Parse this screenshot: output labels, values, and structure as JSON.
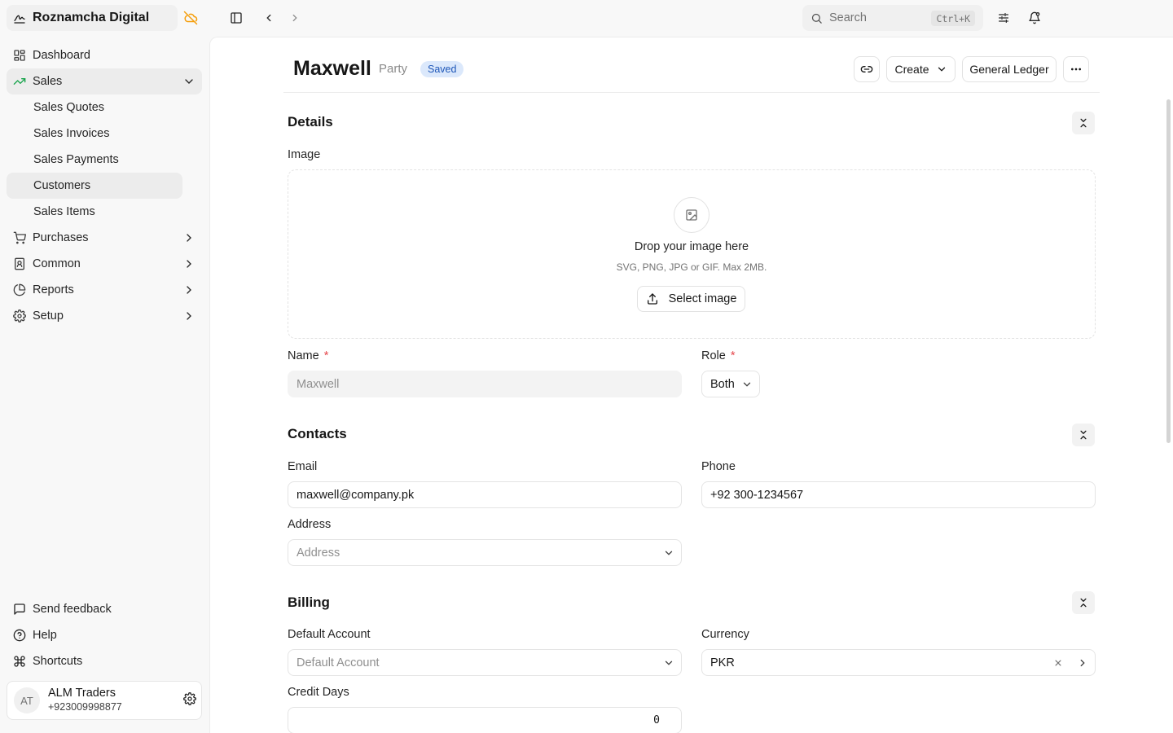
{
  "app": {
    "name": "Roznamcha Digital"
  },
  "sidebar": {
    "items": [
      {
        "label": "Dashboard"
      },
      {
        "label": "Sales",
        "expanded": true
      },
      {
        "label": "Purchases"
      },
      {
        "label": "Common"
      },
      {
        "label": "Reports"
      },
      {
        "label": "Setup"
      }
    ],
    "sales_sub": [
      {
        "label": "Sales Quotes"
      },
      {
        "label": "Sales Invoices"
      },
      {
        "label": "Sales Payments"
      },
      {
        "label": "Customers",
        "active": true
      },
      {
        "label": "Sales Items"
      }
    ],
    "footer": [
      {
        "label": "Send feedback"
      },
      {
        "label": "Help"
      },
      {
        "label": "Shortcuts"
      }
    ],
    "account": {
      "initials": "AT",
      "name": "ALM Traders",
      "phone": "+923009998877"
    }
  },
  "topbar": {
    "search_placeholder": "Search",
    "search_shortcut": "Ctrl+K"
  },
  "doc": {
    "title": "Maxwell",
    "type": "Party",
    "status": "Saved",
    "actions": {
      "create": "Create",
      "ledger": "General Ledger"
    }
  },
  "sections": {
    "details": {
      "title": "Details",
      "image_label": "Image",
      "dropzone_title": "Drop your image here",
      "dropzone_sub": "SVG, PNG, JPG or GIF. Max 2MB.",
      "select_image": "Select image",
      "name_label": "Name",
      "name_value": "Maxwell",
      "role_label": "Role",
      "role_value": "Both",
      "required_mark": "*"
    },
    "contacts": {
      "title": "Contacts",
      "email_label": "Email",
      "email_value": "maxwell@company.pk",
      "phone_label": "Phone",
      "phone_value": "+92 300-1234567",
      "address_label": "Address",
      "address_placeholder": "Address"
    },
    "billing": {
      "title": "Billing",
      "default_account_label": "Default Account",
      "default_account_placeholder": "Default Account",
      "currency_label": "Currency",
      "currency_value": "PKR",
      "credit_days_label": "Credit Days",
      "credit_days_value": "0"
    }
  },
  "colors": {
    "accent": "#1f57b8",
    "badge_bg": "#dbe8fb",
    "offline_icon": "#f59e0b",
    "required": "#e5484d"
  }
}
